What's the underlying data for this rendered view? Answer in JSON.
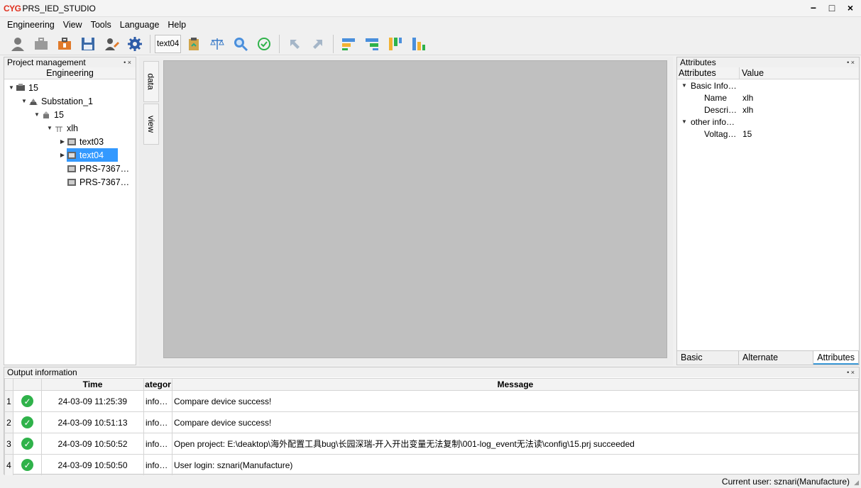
{
  "app": {
    "logo": "CYG",
    "title": "PRS_IED_STUDIO"
  },
  "window_controls": {
    "minimize": "−",
    "maximize": "□",
    "close": "×"
  },
  "menu": [
    "Engineering",
    "View",
    "Tools",
    "Language",
    "Help"
  ],
  "toolbar": {
    "device_label": "text04",
    "icons": [
      "user-icon",
      "briefcase-icon",
      "project-icon",
      "save-icon",
      "user-edit-icon",
      "gear-icon",
      "device-icon",
      "clipboard-icon",
      "balance-icon",
      "search-icon",
      "check-icon",
      "arrow-up-left-icon",
      "arrow-up-right-icon",
      "align-left-icon",
      "align-right-icon",
      "align-top-icon",
      "align-bottom-icon"
    ]
  },
  "project_panel": {
    "title": "Project management",
    "pin": "• ×",
    "column": "Engineering",
    "tree": [
      {
        "label": "15",
        "icon": "folder-icon",
        "expanded": true
      },
      {
        "label": "Substation_1",
        "icon": "substation-icon",
        "expanded": true
      },
      {
        "label": "15",
        "icon": "bay-icon",
        "expanded": true
      },
      {
        "label": "xlh",
        "icon": "line-icon",
        "expanded": true
      },
      {
        "label": "text03",
        "icon": "device-icon",
        "expanded": false
      },
      {
        "label": "text04",
        "icon": "device-icon",
        "expanded": false,
        "selected": true
      },
      {
        "label": "PRS-7367…",
        "icon": "device-icon"
      },
      {
        "label": "PRS-7367…",
        "icon": "device-icon"
      }
    ]
  },
  "center": {
    "tabs": [
      "data",
      "view"
    ]
  },
  "attributes_panel": {
    "title": "Attributes",
    "pin": "• ×",
    "col_attr": "Attributes",
    "col_value": "Value",
    "rows": [
      {
        "label": "Basic Info…",
        "value": ""
      },
      {
        "label": "Name",
        "value": "xlh"
      },
      {
        "label": "Descri…",
        "value": "xlh"
      },
      {
        "label": "other info…",
        "value": ""
      },
      {
        "label": "Voltag…",
        "value": "15"
      }
    ],
    "tabs": [
      "Basic graphics",
      "Alternate graphics",
      "Attributes"
    ]
  },
  "output": {
    "title": "Output information",
    "pin": "• ×",
    "columns": {
      "time": "Time",
      "category": "ategor",
      "message": "Message"
    },
    "rows": [
      {
        "num": "1",
        "time": "24-03-09 11:25:39",
        "category": "info…",
        "message": "Compare device success!"
      },
      {
        "num": "2",
        "time": "24-03-09 10:51:13",
        "category": "info…",
        "message": "Compare device success!"
      },
      {
        "num": "3",
        "time": "24-03-09 10:50:52",
        "category": "info…",
        "message": "Open project: E:\\deaktop\\海外配置工具bug\\长园深瑞-开入开出变量无法复制\\001-log_event无法读\\config\\15.prj succeeded"
      },
      {
        "num": "4",
        "time": "24-03-09 10:50:50",
        "category": "info…",
        "message": "User login: sznari(Manufacture)"
      }
    ]
  },
  "status": {
    "user": "Current user: sznari(Manufacture)"
  }
}
